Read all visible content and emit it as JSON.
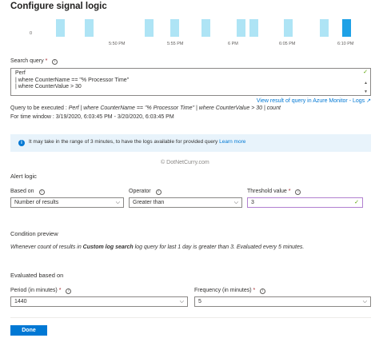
{
  "header": {
    "title": "Configure signal logic"
  },
  "chart_data": {
    "type": "bar",
    "y_zero_label": "0",
    "x_ticks": [
      "5:50 PM",
      "5:55 PM",
      "6 PM",
      "6:05 PM",
      "6:10 PM"
    ],
    "highlight_color": "#1ea1e6",
    "bar_color": "#aee4f5"
  },
  "search_query": {
    "label": "Search query",
    "required": "*",
    "lines": [
      "Perf",
      "| where CounterName == \"% Processor Time\"",
      "| where CounterValue > 30"
    ],
    "view_link": "View result of query in Azure Monitor - Logs",
    "exec_prefix": "Query to be executed : ",
    "exec_query": "Perf | where CounterName == \"% Processor Time\" | where CounterValue > 30 | count",
    "time_window": "For time window : 3/19/2020, 6:03:45 PM - 3/20/2020, 6:03:45 PM"
  },
  "info_banner": {
    "text": "It may take in the range of 3 minutes, to have the logs available for provided query ",
    "link": "Learn more"
  },
  "watermark": {
    "copy": "©",
    "text": "DotNetCurry.com"
  },
  "alert_logic": {
    "title": "Alert logic",
    "based_on": {
      "label": "Based on",
      "value": "Number of results"
    },
    "operator": {
      "label": "Operator",
      "value": "Greater than"
    },
    "threshold": {
      "label": "Threshold value",
      "required": "*",
      "value": "3"
    }
  },
  "condition_preview": {
    "title": "Condition preview",
    "prefix": "Whenever count of results in ",
    "bold": "Custom log search",
    "suffix": " log query for last 1 day is greater than 3. Evaluated every 5 minutes."
  },
  "evaluated": {
    "title": "Evaluated based on",
    "period": {
      "label": "Period (in minutes)",
      "required": "*",
      "value": "1440"
    },
    "frequency": {
      "label": "Frequency (in minutes)",
      "required": "*",
      "value": "5"
    }
  },
  "footer": {
    "done_label": "Done"
  },
  "colors": {
    "accent": "#0078d4",
    "success": "#57a300",
    "required": "#a4262c"
  }
}
